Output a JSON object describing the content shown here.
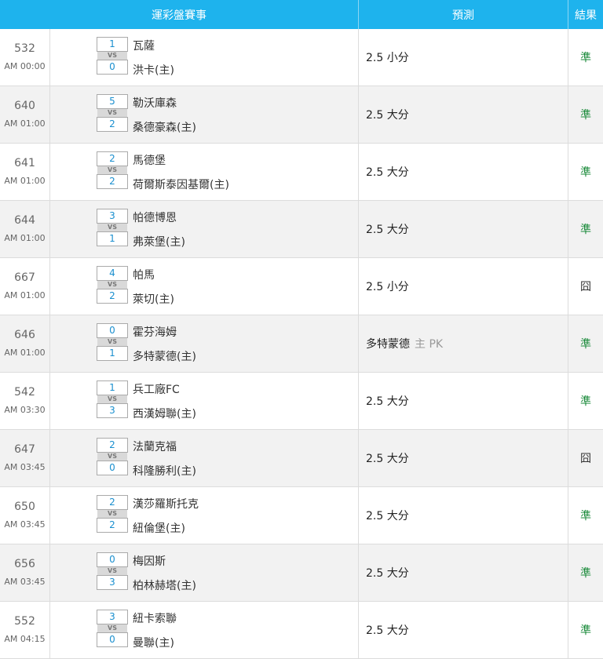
{
  "header": {
    "col_match": "運彩盤賽事",
    "col_pred": "預測",
    "col_result": "結果"
  },
  "colors": {
    "header_bg": "#1eb3ed",
    "hit": "#1a8a3a",
    "miss": "#333333"
  },
  "rows": [
    {
      "id": "532",
      "time": "AM 00:00",
      "s1": "1",
      "vs": "VS",
      "s2": "0",
      "team1": "瓦薩",
      "team2": "洪卡(主)",
      "pred_main": "2.5 小分",
      "pred_extra": "",
      "result": "準",
      "hit": true
    },
    {
      "id": "640",
      "time": "AM 01:00",
      "s1": "5",
      "vs": "VS",
      "s2": "2",
      "team1": "勒沃庫森",
      "team2": "桑德豪森(主)",
      "pred_main": "2.5 大分",
      "pred_extra": "",
      "result": "準",
      "hit": true
    },
    {
      "id": "641",
      "time": "AM 01:00",
      "s1": "2",
      "vs": "VS",
      "s2": "2",
      "team1": "馬德堡",
      "team2": "荷爾斯泰因基爾(主)",
      "pred_main": "2.5 大分",
      "pred_extra": "",
      "result": "準",
      "hit": true
    },
    {
      "id": "644",
      "time": "AM 01:00",
      "s1": "3",
      "vs": "VS",
      "s2": "1",
      "team1": "帕德博恩",
      "team2": "弗萊堡(主)",
      "pred_main": "2.5 大分",
      "pred_extra": "",
      "result": "準",
      "hit": true
    },
    {
      "id": "667",
      "time": "AM 01:00",
      "s1": "4",
      "vs": "VS",
      "s2": "2",
      "team1": "帕馬",
      "team2": "萊切(主)",
      "pred_main": "2.5 小分",
      "pred_extra": "",
      "result": "囧",
      "hit": false
    },
    {
      "id": "646",
      "time": "AM 01:00",
      "s1": "0",
      "vs": "VS",
      "s2": "1",
      "team1": "霍芬海姆",
      "team2": "多特蒙德(主)",
      "pred_main": "多特蒙德",
      "pred_extra": "主 PK",
      "result": "準",
      "hit": true
    },
    {
      "id": "542",
      "time": "AM 03:30",
      "s1": "1",
      "vs": "VS",
      "s2": "3",
      "team1": "兵工廠FC",
      "team2": "西漢姆聯(主)",
      "pred_main": "2.5 大分",
      "pred_extra": "",
      "result": "準",
      "hit": true
    },
    {
      "id": "647",
      "time": "AM 03:45",
      "s1": "2",
      "vs": "VS",
      "s2": "0",
      "team1": "法蘭克福",
      "team2": "科隆勝利(主)",
      "pred_main": "2.5 大分",
      "pred_extra": "",
      "result": "囧",
      "hit": false
    },
    {
      "id": "650",
      "time": "AM 03:45",
      "s1": "2",
      "vs": "VS",
      "s2": "2",
      "team1": "漢莎羅斯托克",
      "team2": "紐倫堡(主)",
      "pred_main": "2.5 大分",
      "pred_extra": "",
      "result": "準",
      "hit": true
    },
    {
      "id": "656",
      "time": "AM 03:45",
      "s1": "0",
      "vs": "VS",
      "s2": "3",
      "team1": "梅因斯",
      "team2": "柏林赫塔(主)",
      "pred_main": "2.5 大分",
      "pred_extra": "",
      "result": "準",
      "hit": true
    },
    {
      "id": "552",
      "time": "AM 04:15",
      "s1": "3",
      "vs": "VS",
      "s2": "0",
      "team1": "紐卡索聯",
      "team2": "曼聯(主)",
      "pred_main": "2.5 大分",
      "pred_extra": "",
      "result": "準",
      "hit": true
    }
  ]
}
